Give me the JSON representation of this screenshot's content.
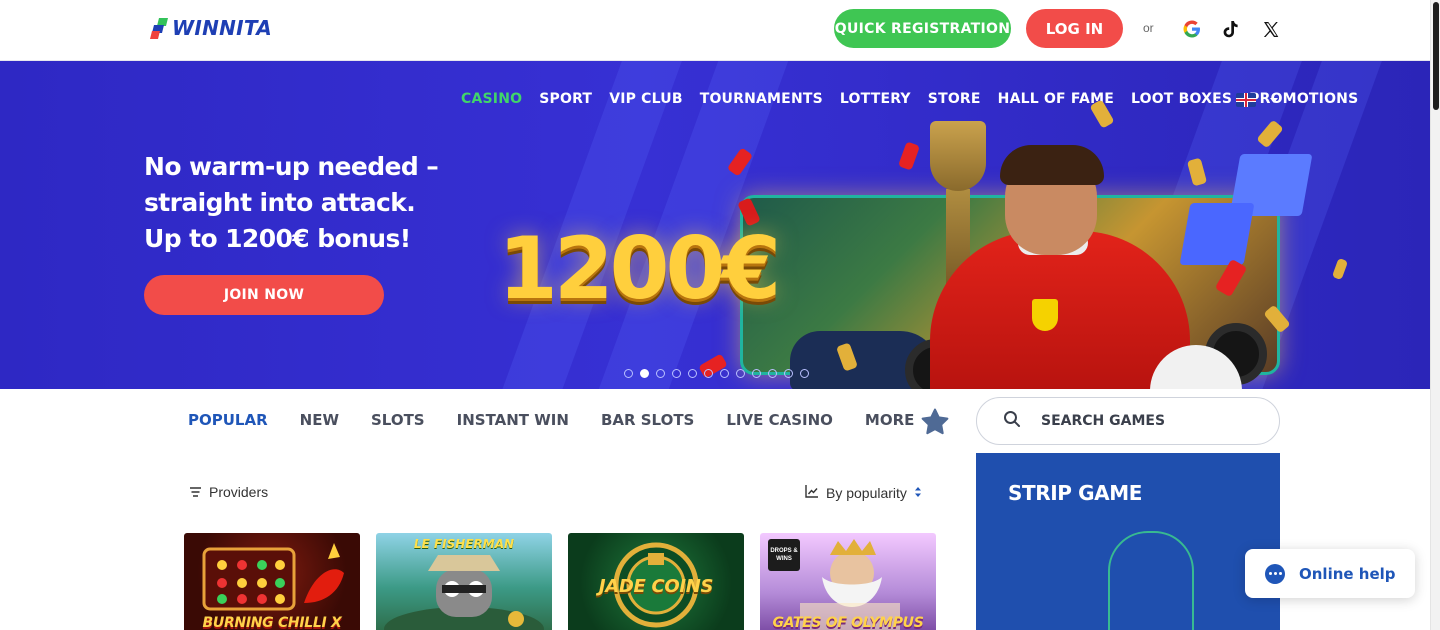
{
  "header": {
    "logo_text": "WINNITA",
    "register_label": "QUICK REGISTRATION",
    "login_label": "LOG IN",
    "or_text": "or",
    "social_icons": [
      "google-icon",
      "tiktok-icon",
      "x-icon"
    ]
  },
  "nav": {
    "items": [
      "CASINO",
      "SPORT",
      "VIP CLUB",
      "TOURNAMENTS",
      "LOTTERY",
      "STORE",
      "HALL OF FAME",
      "LOOT BOXES",
      "PROMOTIONS"
    ],
    "active": "CASINO",
    "language_icon": "uk-flag-icon"
  },
  "hero": {
    "headline_lines": [
      "No warm-up needed –",
      "straight into attack.",
      "Up to 1200€ bonus!"
    ],
    "cta_label": "JOIN NOW",
    "bonus_amount": "1200€",
    "slide_count": 12,
    "active_slide": 2
  },
  "categories": {
    "tabs": [
      "POPULAR",
      "NEW",
      "SLOTS",
      "INSTANT WIN",
      "BAR SLOTS",
      "LIVE CASINO"
    ],
    "more_label": "MORE",
    "active": "POPULAR"
  },
  "search": {
    "placeholder": "SEARCH GAMES"
  },
  "filters": {
    "providers_label": "Providers",
    "sort_label": "By popularity"
  },
  "games": [
    {
      "title": "BURNING CHILLI X"
    },
    {
      "title": "LE FISHERMAN"
    },
    {
      "title": "JADE COINS"
    },
    {
      "title": "GATES OF OLYMPUS",
      "badge": "DROPS & WINS"
    }
  ],
  "strip_game": {
    "title": "STRIP GAME"
  },
  "help": {
    "label": "Online help"
  },
  "colors": {
    "brand_blue": "#1e3fb4",
    "hero_bg": "#3730d4",
    "register_green": "#3fc653",
    "login_red": "#f24c49",
    "nav_active": "#41d46a",
    "tab_active": "#1f56b8"
  }
}
